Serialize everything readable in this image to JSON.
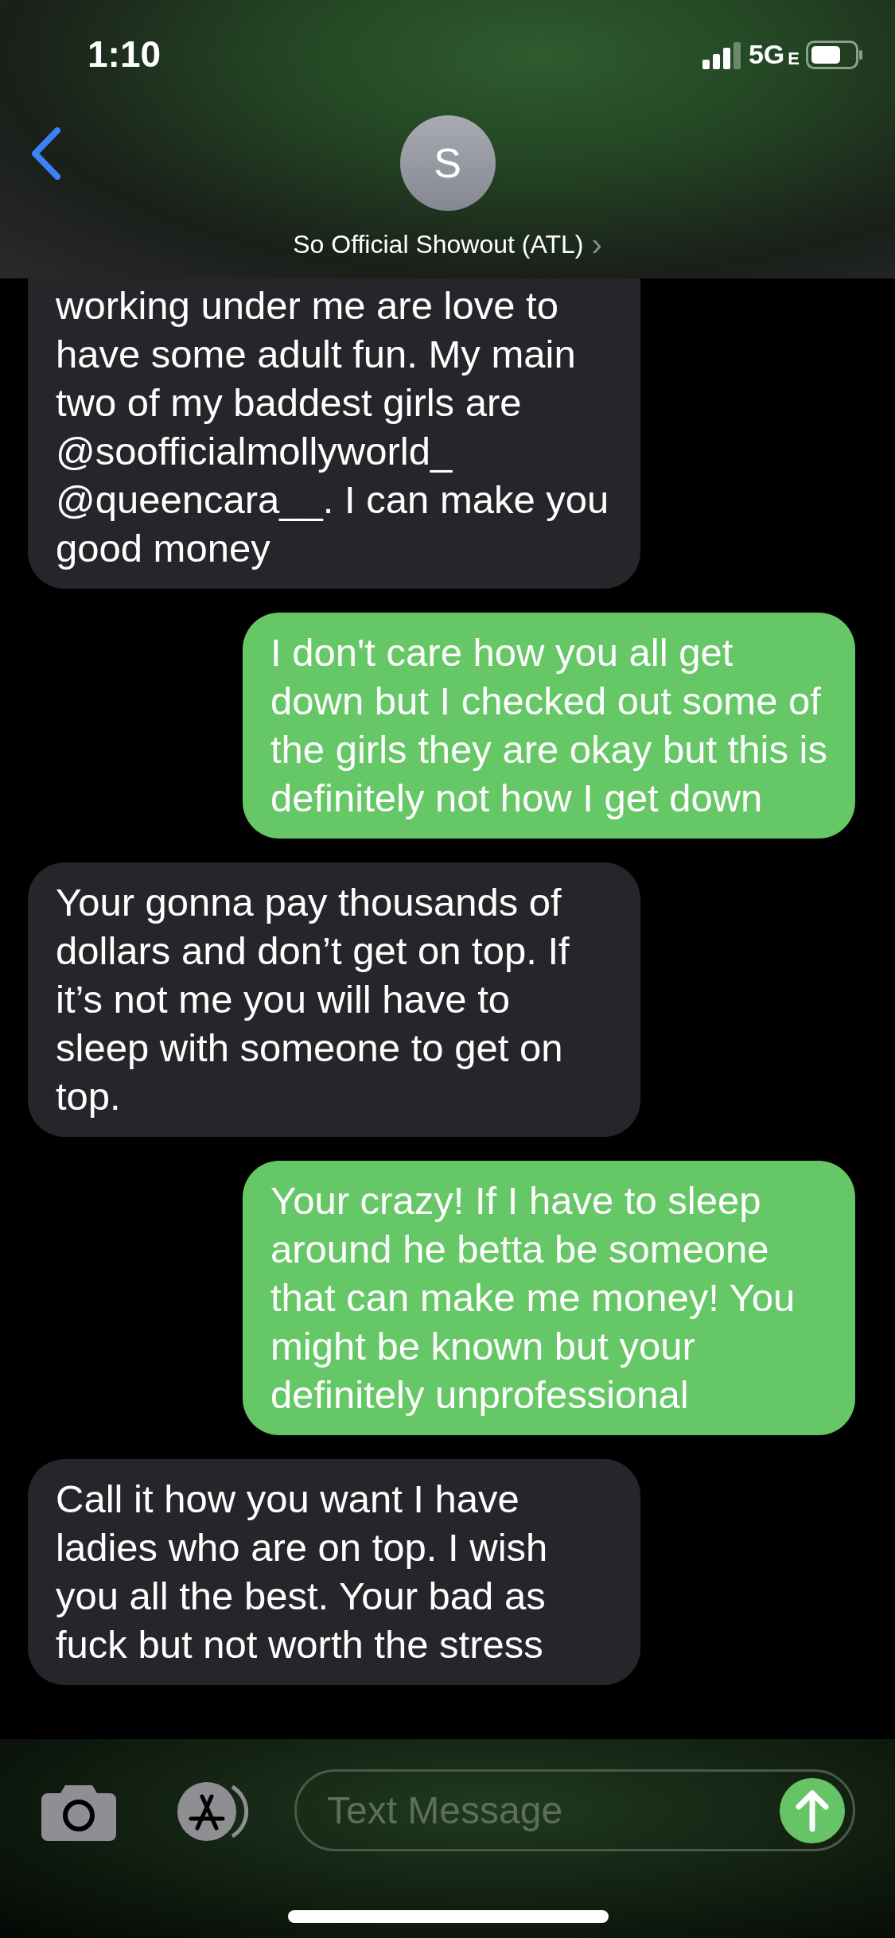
{
  "status_bar": {
    "time": "1:10",
    "network": "5G",
    "network_suffix": "E"
  },
  "header": {
    "avatar_initial": "S",
    "contact_name": "So Official Showout (ATL)",
    "chevron": "›"
  },
  "messages": [
    {
      "kind": "incoming",
      "text": "working under me are love to have some adult fun. My main two of my baddest girls are @soofficialmollyworld_ @queencara__. I can make you good money",
      "cut_top": true
    },
    {
      "kind": "outgoing",
      "text": "I don't care how you all get down but I checked out some of the girls they are okay but this is definitely not how I get down",
      "cut_top": false
    },
    {
      "kind": "incoming",
      "text": "Your gonna pay thousands of dollars and don’t get on top. If it’s not me you will have to sleep with someone to get on top.",
      "cut_top": false
    },
    {
      "kind": "outgoing",
      "text": "Your crazy! If I have to sleep around he betta be someone that can make me money! You might be known but your definitely unprofessional",
      "cut_top": false
    },
    {
      "kind": "incoming",
      "text": "Call it how you want I have ladies who are on top. I wish you all the best. Your bad as fuck but not worth the stress",
      "cut_top": false
    }
  ],
  "composer": {
    "placeholder": "Text Message"
  }
}
